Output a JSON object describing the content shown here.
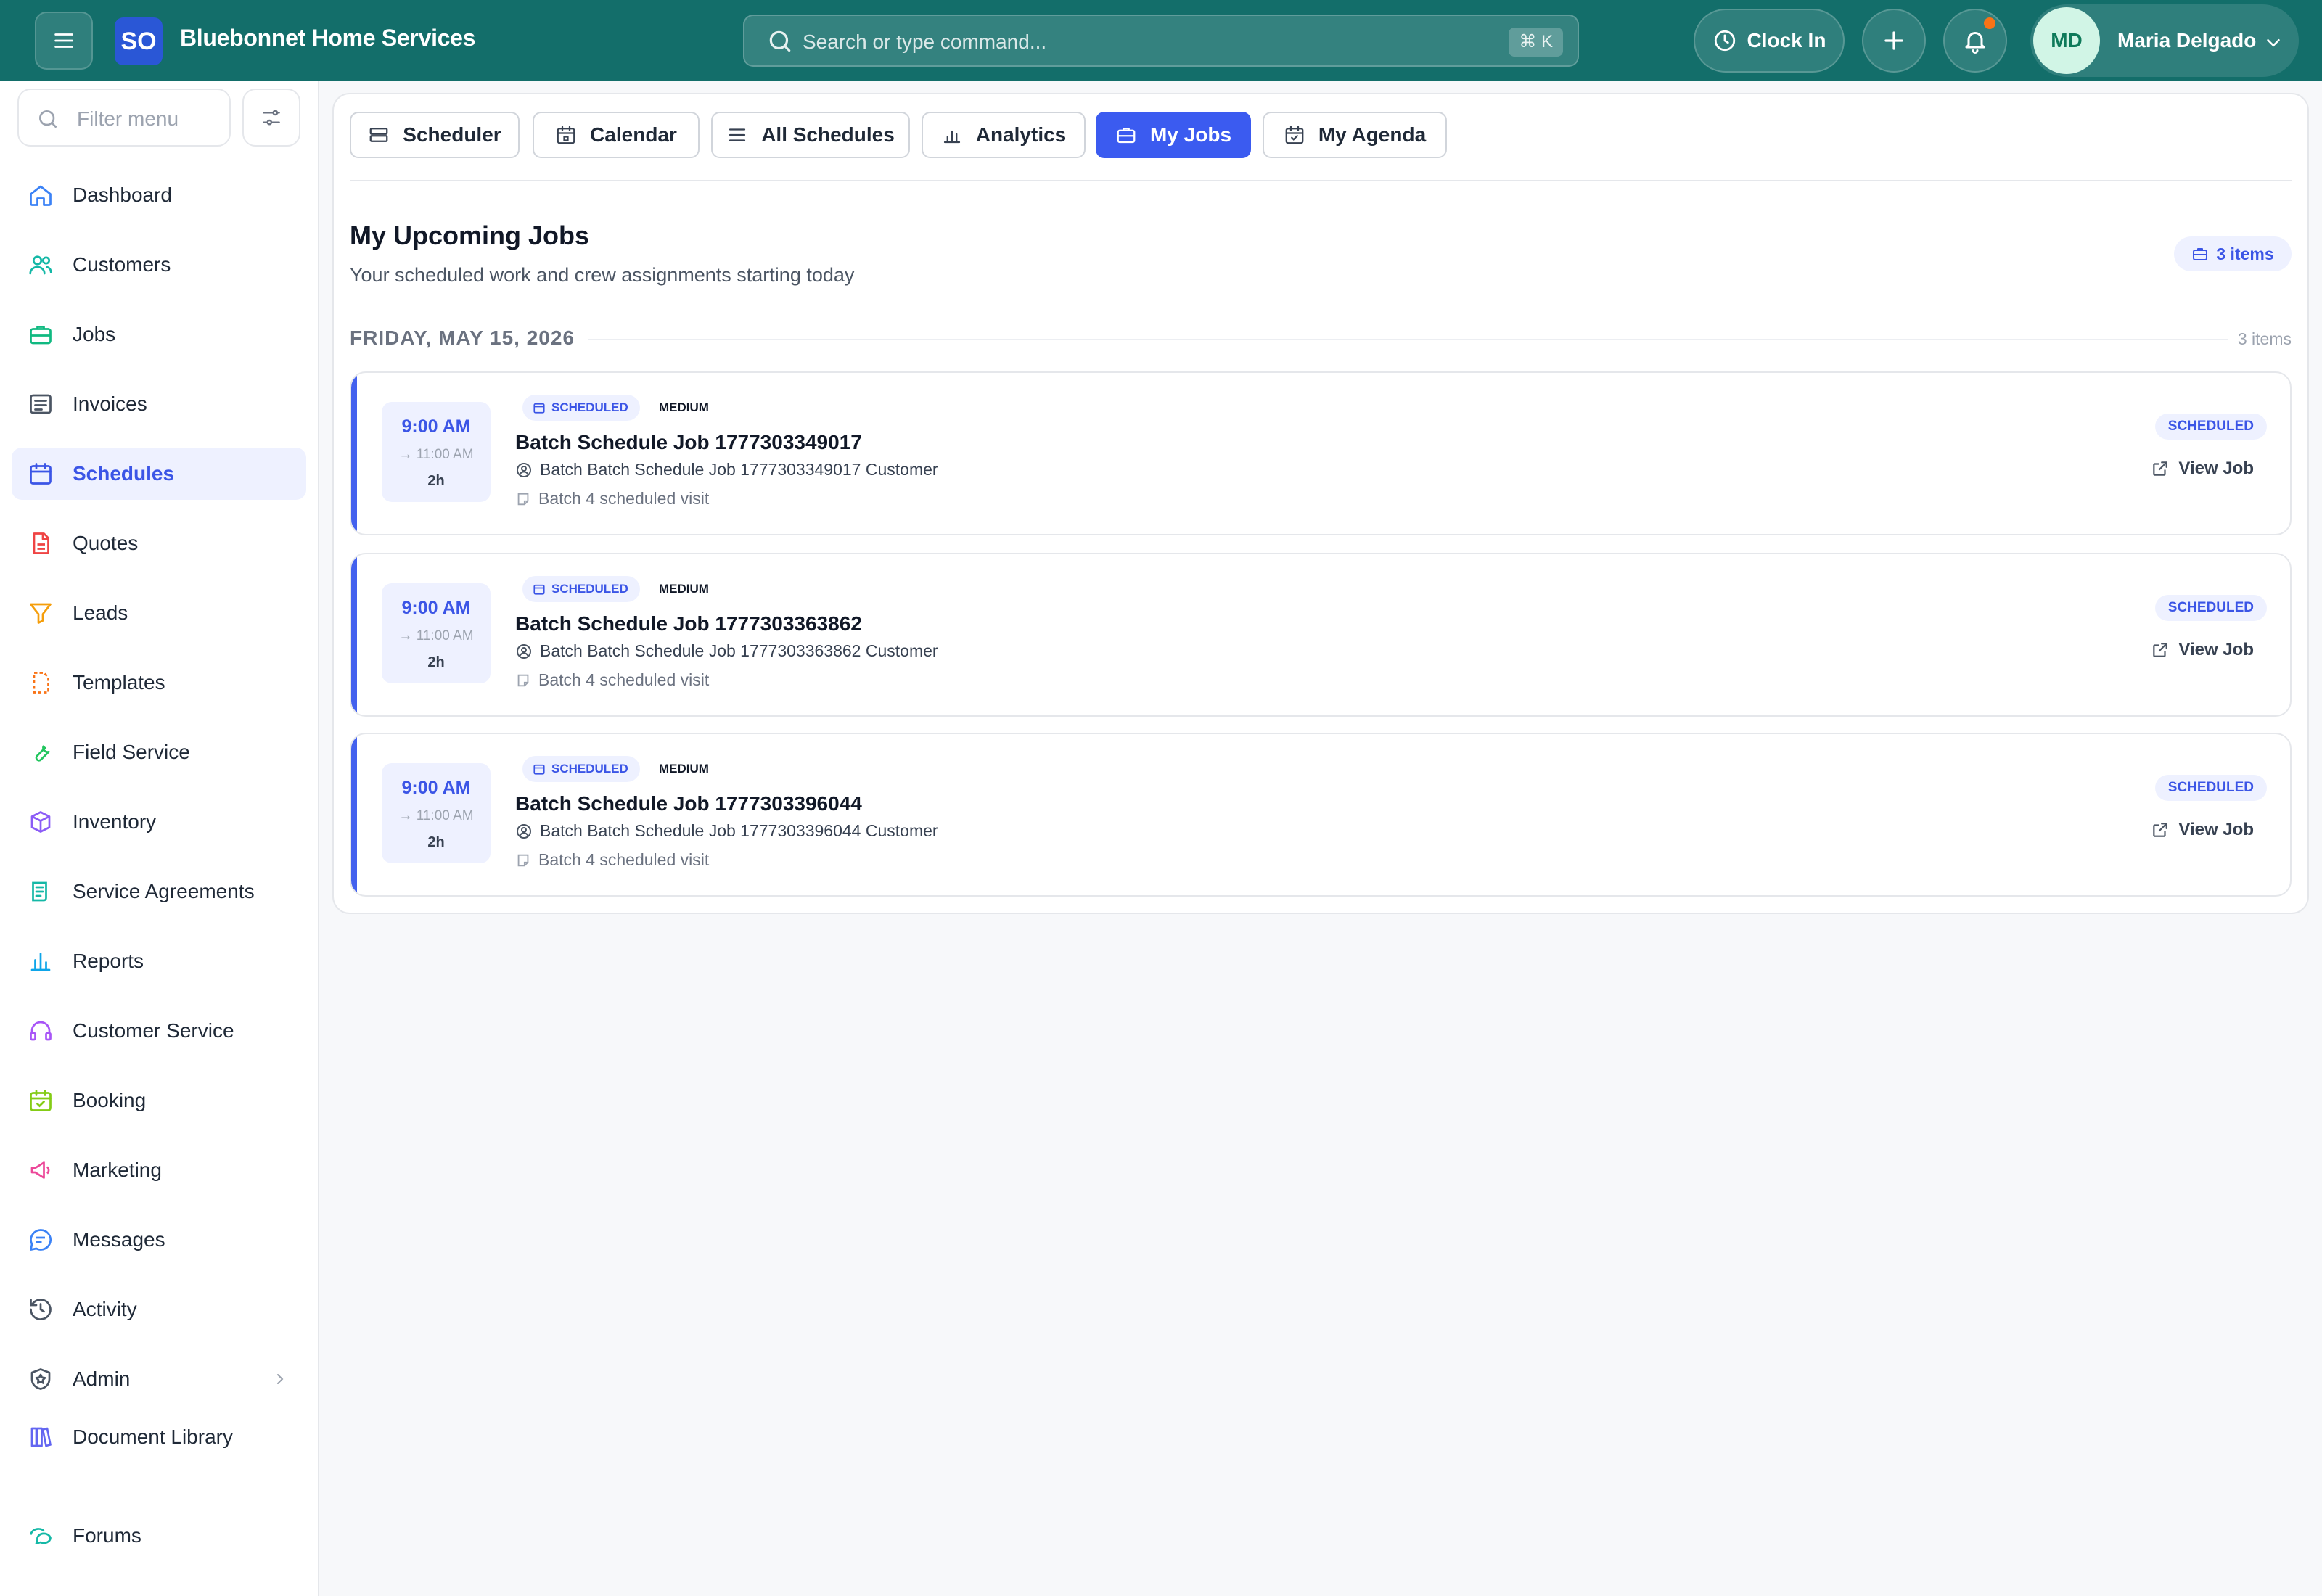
{
  "app": {
    "brand_initials": "SO",
    "brand_name": "Bluebonnet Home Services",
    "accent_color": "#3b5bf0",
    "topbar_color": "#136e6a"
  },
  "header": {
    "search_placeholder": "Search or type command...",
    "search_shortcut": "⌘ K",
    "clock_in_label": "Clock In",
    "user_initials": "MD",
    "user_name": "Maria Delgado"
  },
  "sidebar": {
    "filter_placeholder": "Filter menu",
    "items": [
      {
        "label": "Dashboard",
        "icon": "home-icon"
      },
      {
        "label": "Customers",
        "icon": "users-icon"
      },
      {
        "label": "Jobs",
        "icon": "briefcase-icon"
      },
      {
        "label": "Invoices",
        "icon": "invoice-icon"
      },
      {
        "label": "Schedules",
        "icon": "calendar-icon",
        "active": true
      },
      {
        "label": "Quotes",
        "icon": "document-icon"
      },
      {
        "label": "Leads",
        "icon": "funnel-icon"
      },
      {
        "label": "Templates",
        "icon": "template-icon"
      },
      {
        "label": "Field Service",
        "icon": "wrench-icon"
      },
      {
        "label": "Inventory",
        "icon": "box-icon"
      },
      {
        "label": "Service Agreements",
        "icon": "scroll-icon"
      },
      {
        "label": "Reports",
        "icon": "bar-chart-icon"
      },
      {
        "label": "Customer Service",
        "icon": "headset-icon"
      },
      {
        "label": "Booking",
        "icon": "calendar-check-icon"
      },
      {
        "label": "Marketing",
        "icon": "megaphone-icon"
      },
      {
        "label": "Messages",
        "icon": "chat-icon"
      },
      {
        "label": "Activity",
        "icon": "history-icon"
      },
      {
        "label": "Admin",
        "icon": "shield-icon"
      },
      {
        "label": "Document Library",
        "icon": "library-icon"
      },
      {
        "label": "Forums",
        "icon": "forum-icon"
      }
    ]
  },
  "tabs": [
    {
      "label": "Scheduler",
      "icon": "scheduler-icon"
    },
    {
      "label": "Calendar",
      "icon": "calendar-icon"
    },
    {
      "label": "All Schedules",
      "icon": "list-icon"
    },
    {
      "label": "Analytics",
      "icon": "analytics-icon"
    },
    {
      "label": "My Jobs",
      "icon": "briefcase-icon",
      "active": true
    },
    {
      "label": "My Agenda",
      "icon": "agenda-icon"
    }
  ],
  "main": {
    "title": "My Upcoming Jobs",
    "subtitle": "Your scheduled work and crew assignments starting today",
    "count_label": "3 items",
    "date_heading": "FRIDAY, MAY 15, 2026",
    "date_count": "3 items"
  },
  "jobs": [
    {
      "start": "9:00 AM",
      "end": "→ 11:00 AM",
      "duration": "2h",
      "badge": "SCHEDULED",
      "priority": "MEDIUM",
      "title": "Batch Schedule Job 1777303349017",
      "customer": "Batch Batch Schedule Job 1777303349017 Customer",
      "note": "Batch 4 scheduled visit",
      "status": "SCHEDULED",
      "action": "View Job"
    },
    {
      "start": "9:00 AM",
      "end": "→ 11:00 AM",
      "duration": "2h",
      "badge": "SCHEDULED",
      "priority": "MEDIUM",
      "title": "Batch Schedule Job 1777303363862",
      "customer": "Batch Batch Schedule Job 1777303363862 Customer",
      "note": "Batch 4 scheduled visit",
      "status": "SCHEDULED",
      "action": "View Job"
    },
    {
      "start": "9:00 AM",
      "end": "→ 11:00 AM",
      "duration": "2h",
      "badge": "SCHEDULED",
      "priority": "MEDIUM",
      "title": "Batch Schedule Job 1777303396044",
      "customer": "Batch Batch Schedule Job 1777303396044 Customer",
      "note": "Batch 4 scheduled visit",
      "status": "SCHEDULED",
      "action": "View Job"
    }
  ]
}
